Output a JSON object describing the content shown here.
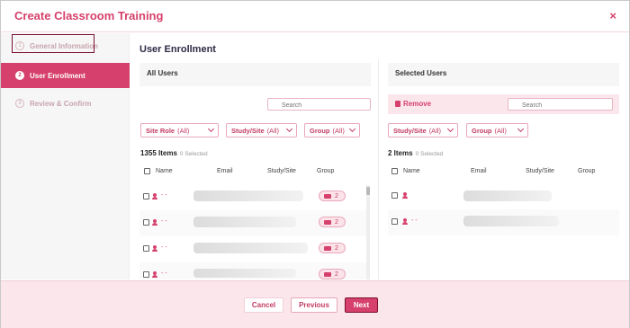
{
  "dialog": {
    "title": "Create Classroom Training",
    "close_glyph": "×"
  },
  "steps": [
    {
      "number": "1",
      "label": "General Information",
      "state": "inactive"
    },
    {
      "number": "2",
      "label": "User Enrollment",
      "state": "active"
    },
    {
      "number": "3",
      "label": "Review & Confirm",
      "state": "inactive"
    }
  ],
  "main": {
    "title": "User Enrollment"
  },
  "all_users": {
    "header": "All Users",
    "search_placeholder": "Search",
    "filters": [
      {
        "label": "Site Role",
        "value": "(All)"
      },
      {
        "label": "Study/Site",
        "value": "(All)"
      },
      {
        "label": "Group",
        "value": "(All)"
      }
    ],
    "count_label": "1355 Items",
    "selected_label": "0 Selected",
    "columns": [
      "Name",
      "Email",
      "Study/Site",
      "Group"
    ],
    "rows": [
      {
        "name": "- -",
        "group_count": "2"
      },
      {
        "name": "- -",
        "group_count": "2"
      },
      {
        "name": "- -",
        "group_count": "2"
      },
      {
        "name": "- -",
        "group_count": "2"
      }
    ]
  },
  "selected_users": {
    "header": "Selected Users",
    "remove_label": "Remove",
    "search_placeholder": "Search",
    "filters": [
      {
        "label": "Study/Site",
        "value": "(All)"
      },
      {
        "label": "Group",
        "value": "(All)"
      }
    ],
    "count_label": "2 Items",
    "selected_label": "0 Selected",
    "columns": [
      "Name",
      "Email",
      "Study/Site",
      "Group"
    ],
    "rows": [
      {
        "name": ""
      },
      {
        "name": "- -"
      }
    ]
  },
  "footer": {
    "cancel_label": "Cancel",
    "previous_label": "Previous",
    "next_label": "Next"
  },
  "colors": {
    "accent": "#d6406c",
    "accent_dark": "#7a0f2e",
    "footer_bg": "#fbe6ec",
    "sidebar_bg": "#f6f6f6"
  },
  "icons": {
    "user": "user-icon",
    "group": "group-icon",
    "trash": "trash-icon",
    "search": "search-icon",
    "close": "close-icon",
    "chevron": "chevron-down-icon"
  }
}
